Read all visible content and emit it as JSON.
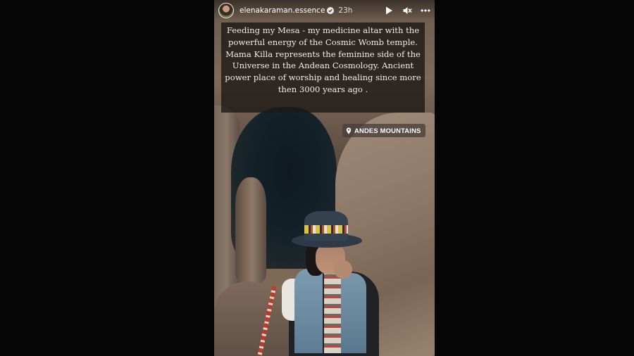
{
  "story": {
    "username": "elenakaraman.essence",
    "time": "23h",
    "caption": "Feeding my Mesa - my medicine altar with the powerful energy of the Cosmic Womb temple. Mama Killa represents the feminine side of the Universe in the Andean Cosmology. Ancient power place of worship and healing since more then 3000 years ago .",
    "location": "ANDES MOUNTAINS"
  },
  "icons": {
    "verified": "verified-badge-icon",
    "play": "play-icon",
    "mute": "speaker-muted-icon",
    "more": "more-dots-icon",
    "location": "location-pin-icon"
  }
}
